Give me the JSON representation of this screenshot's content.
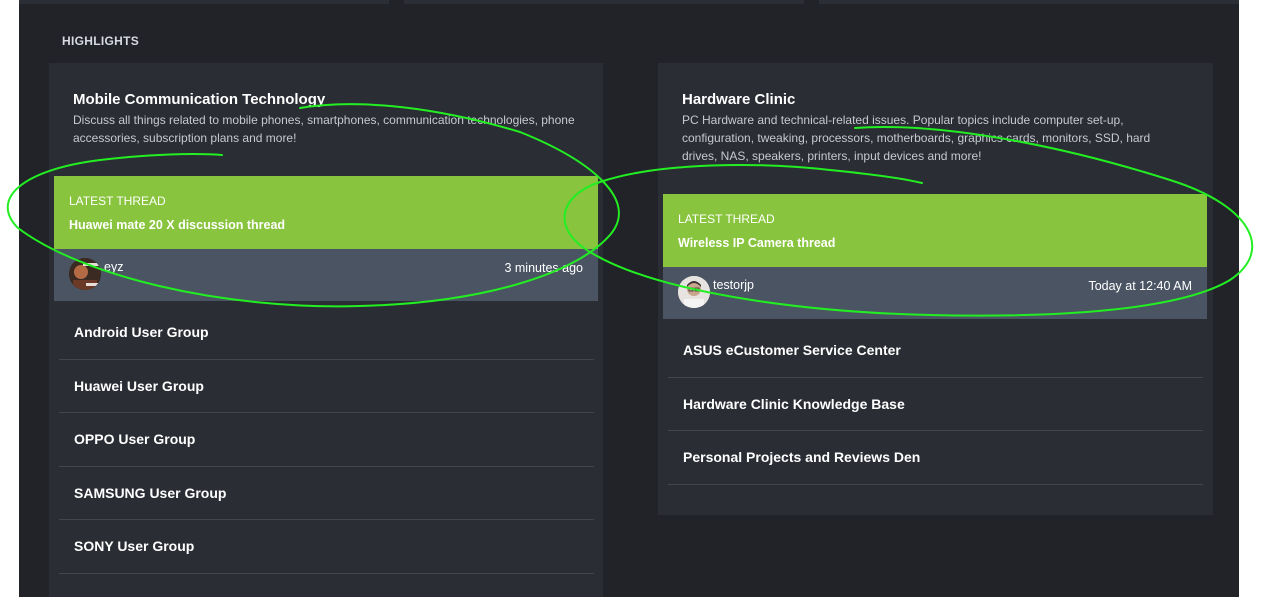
{
  "section": {
    "label": "HIGHLIGHTS"
  },
  "colors": {
    "accent_green": "#88c43d",
    "meta_bar": "#4a5463",
    "annotation": "#22ee22"
  },
  "left": {
    "title": "Mobile Communication Technology",
    "description": "Discuss all things related to mobile phones, smartphones, communication technologies, phone accessories, subscription plans and more!",
    "latest": {
      "label": "LATEST THREAD",
      "title": "Huawei mate 20 X discussion thread",
      "user": "eyz",
      "time": "3 minutes ago",
      "avatar_icon": "user-avatar-icon"
    },
    "subforums": [
      "Android User Group",
      "Huawei User Group",
      "OPPO User Group",
      "SAMSUNG User Group",
      "SONY User Group"
    ]
  },
  "right": {
    "title": "Hardware Clinic",
    "description": "PC Hardware and technical-related issues. Popular topics include computer set-up, configuration, tweaking, processors, motherboards, graphics cards, monitors, SSD, hard drives, NAS, speakers, printers, input devices and more!",
    "latest": {
      "label": "LATEST THREAD",
      "title": "Wireless IP Camera thread",
      "user": "testorjp",
      "time": "Today at 12:40 AM",
      "avatar_icon": "user-avatar-icon"
    },
    "subforums": [
      "ASUS eCustomer Service Center",
      "Hardware Clinic Knowledge Base",
      "Personal Projects and Reviews Den"
    ]
  }
}
